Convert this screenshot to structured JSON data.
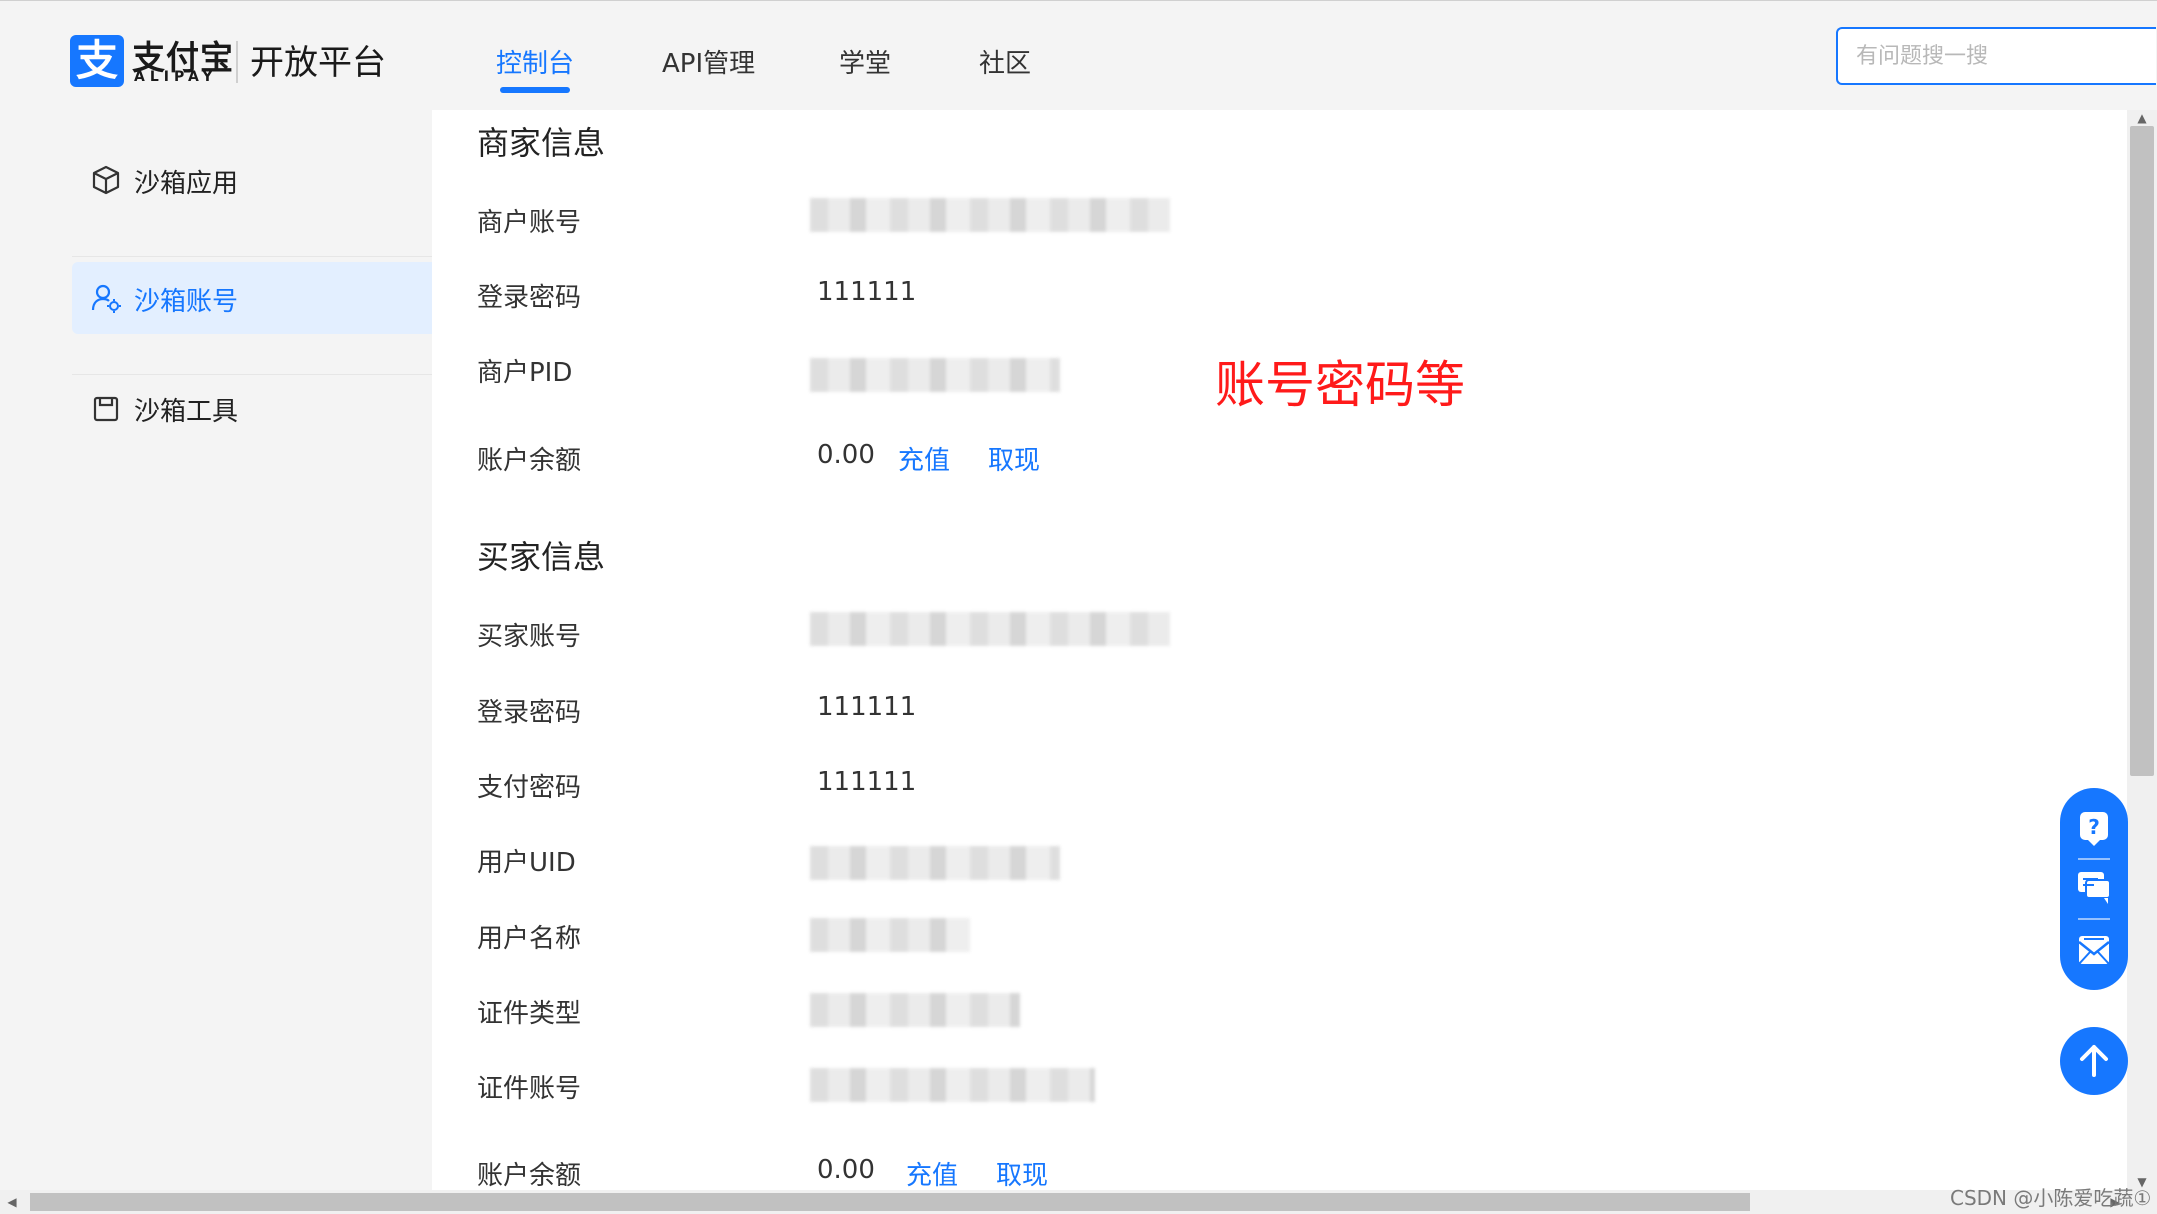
{
  "header": {
    "logo_mark": "支",
    "logo_cn": "支付宝",
    "logo_en": "ALIPAY",
    "platform": "开放平台",
    "nav": [
      {
        "label": "控制台"
      },
      {
        "label": "API管理"
      },
      {
        "label": "学堂"
      },
      {
        "label": "社区"
      }
    ],
    "search_placeholder": "有问题搜一搜"
  },
  "sidebar": {
    "items": [
      {
        "label": "沙箱应用",
        "icon": "cube-icon"
      },
      {
        "label": "沙箱账号",
        "icon": "user-settings-icon"
      },
      {
        "label": "沙箱工具",
        "icon": "bag-icon"
      }
    ]
  },
  "merchant": {
    "title": "商家信息",
    "rows": [
      {
        "label": "商户账号"
      },
      {
        "label": "登录密码",
        "value": "111111"
      },
      {
        "label": "商户PID"
      },
      {
        "label": "账户余额",
        "value": "0.00",
        "links": [
          "充值",
          "取现"
        ]
      }
    ]
  },
  "buyer": {
    "title": "买家信息",
    "rows": [
      {
        "label": "买家账号"
      },
      {
        "label": "登录密码",
        "value": "111111"
      },
      {
        "label": "支付密码",
        "value": "111111"
      },
      {
        "label": "用户UID"
      },
      {
        "label": "用户名称"
      },
      {
        "label": "证件类型"
      },
      {
        "label": "证件账号"
      },
      {
        "label": "账户余额",
        "value": "0.00",
        "links": [
          "充值",
          "取现"
        ]
      }
    ]
  },
  "annotation": "账号密码等",
  "watermark": "CSDN @小陈爱吃蔬①",
  "colors": {
    "accent": "#1677ff",
    "annotation": "#ff1a1a",
    "active_bg": "#e3efff"
  }
}
